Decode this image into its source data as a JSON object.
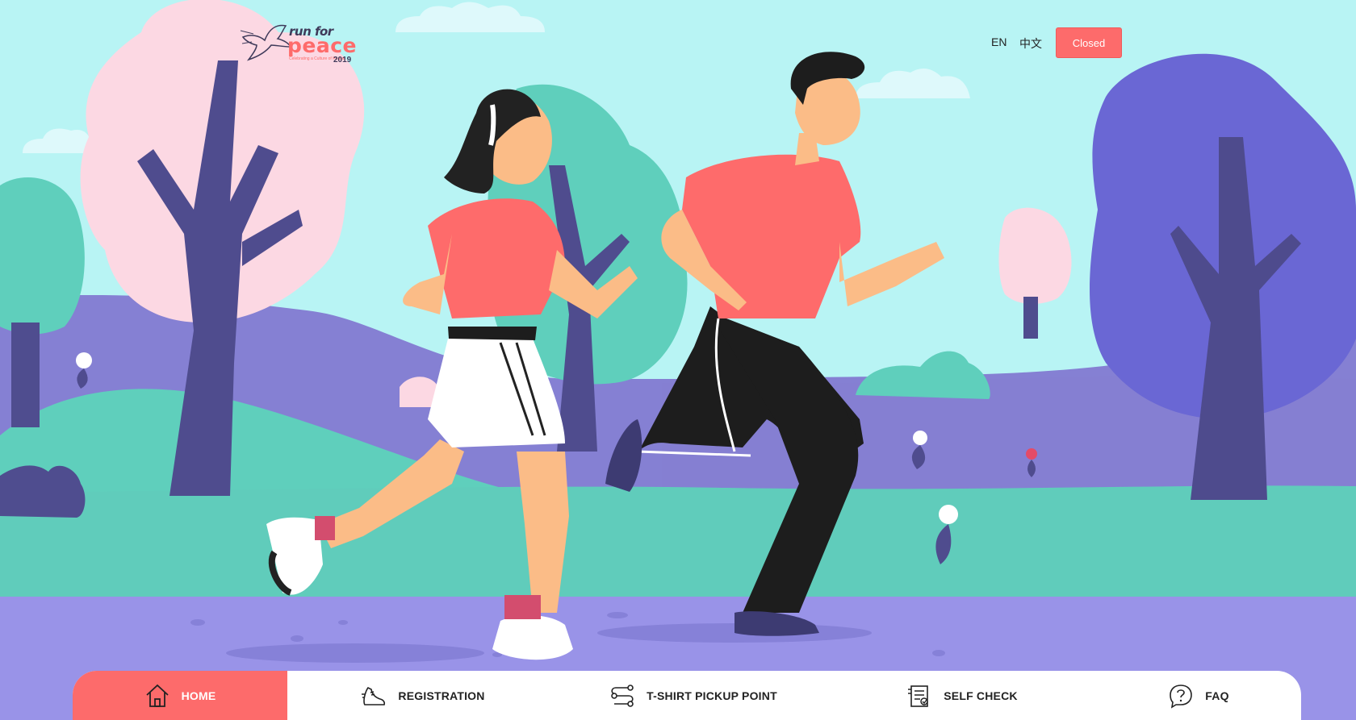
{
  "brand": {
    "logo_line1": "run for",
    "logo_line2": "peace",
    "logo_tagline": "Celebrating a Culture of Peace",
    "logo_year": "2019",
    "accent_color": "#fd6b6b"
  },
  "header": {
    "lang_en": "EN",
    "lang_zh": "中文",
    "status_button": "Closed"
  },
  "nav": {
    "items": [
      {
        "label": "HOME",
        "icon": "home-icon",
        "active": true
      },
      {
        "label": "REGISTRATION",
        "icon": "running-shoe-icon",
        "active": false
      },
      {
        "label": "T-SHIRT PICKUP POINT",
        "icon": "route-icon",
        "active": false
      },
      {
        "label": "SELF CHECK",
        "icon": "checklist-icon",
        "active": false
      },
      {
        "label": "FAQ",
        "icon": "question-icon",
        "active": false
      }
    ]
  }
}
